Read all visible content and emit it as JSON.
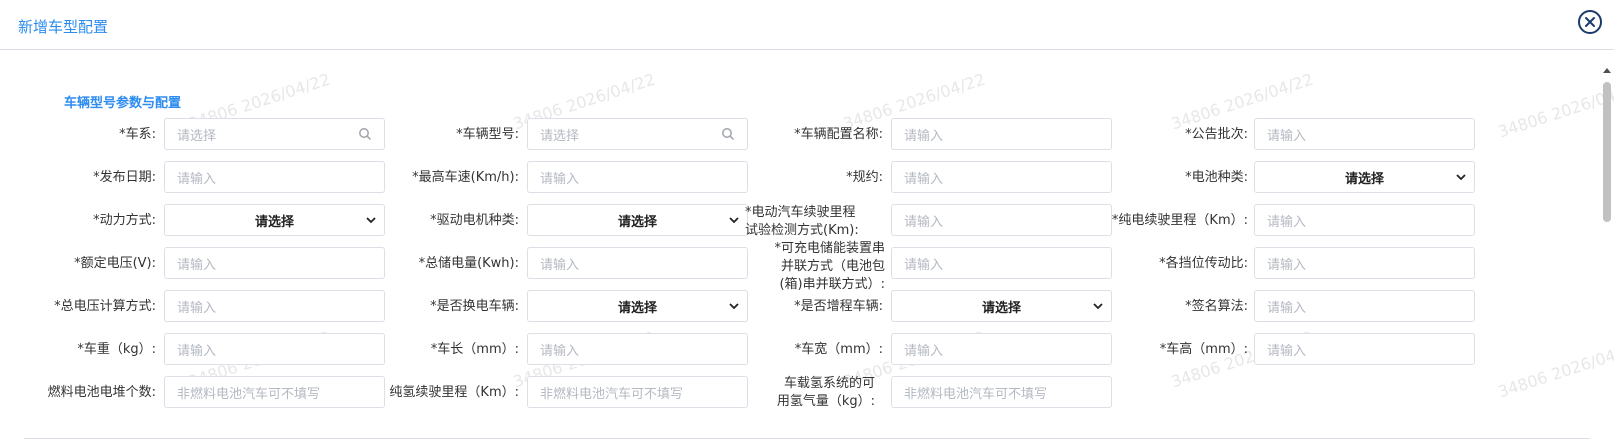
{
  "dialog": {
    "title": "新增车型配置"
  },
  "section": {
    "title": "车辆型号参数与配置"
  },
  "watermark_text": "34806 2026/04/22",
  "placeholders": {
    "select": "请选择",
    "input": "请输入",
    "fuel_cell": "非燃料电池汽车可不填写"
  },
  "fields": {
    "vehicle_series": "*车系:",
    "vehicle_model": "*车辆型号:",
    "config_name": "*车辆配置名称:",
    "announcement_batch": "*公告批次:",
    "release_date": "*发布日期:",
    "max_speed": "*最高车速(Km/h):",
    "regulation": "*规约:",
    "battery_type": "*电池种类:",
    "power_mode": "*动力方式:",
    "drive_motor_type": "*驱动电机种类:",
    "range_test_method_l1": "*电动汽车续驶里程",
    "range_test_method_l2": "试验检测方式(Km):",
    "pure_electric_range": "*纯电续驶里程（Km）:",
    "rated_voltage": "*额定电压(V):",
    "total_energy": "*总储电量(Kwh):",
    "rechargeable_l1": "*可充电储能装置串",
    "rechargeable_l2": "并联方式（电池包",
    "rechargeable_l3": "(箱)串并联方式）:",
    "gear_ratio": "*各挡位传动比:",
    "total_voltage_calc": "*总电压计算方式:",
    "battery_swap": "*是否换电车辆:",
    "range_extender": "*是否增程车辆:",
    "signature_algorithm": "*签名算法:",
    "vehicle_weight": "*车重（kg）:",
    "vehicle_length": "*车长（mm）:",
    "vehicle_width": "*车宽（mm）:",
    "vehicle_height": "*车高（mm）:",
    "fuel_cell_stack_count": "燃料电池电堆个数:",
    "hydrogen_range": "纯氢续驶里程（Km）:",
    "hydrogen_capacity_l1": "车载氢系统的可",
    "hydrogen_capacity_l2": "用氢气量（kg）:"
  },
  "icons": {
    "close": "close-circle-icon",
    "search": "search-icon",
    "select_arrow": "chevron-down-icon"
  },
  "colors": {
    "title": "#2d8cf0",
    "border": "#dcdfe6",
    "placeholder": "#b4b9c2",
    "close": "#1a3a6b"
  }
}
